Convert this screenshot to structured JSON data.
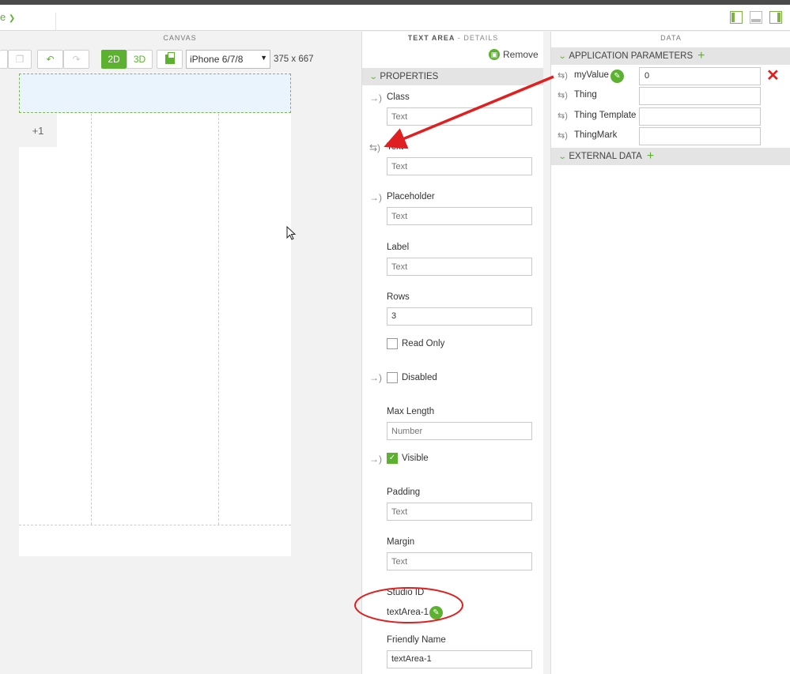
{
  "toolbar": {
    "menu_label": "e",
    "menu_chevron": "chevron-down-icon",
    "layout_icons": [
      "left-panel-layout-icon",
      "bottom-panel-layout-icon",
      "right-panel-layout-icon"
    ]
  },
  "canvas": {
    "header": "CANVAS",
    "mode_2d": "2D",
    "mode_3d": "3D",
    "device": "iPhone 6/7/8",
    "resolution": "375 x 667",
    "plus_badge": "+1"
  },
  "details": {
    "header_title": "TEXT AREA",
    "header_sub": " - DETAILS",
    "remove_label": "Remove",
    "section_properties": "PROPERTIES",
    "props": {
      "class_label": "Class",
      "class_placeholder": "Text",
      "text_label": "Text",
      "text_placeholder": "Text",
      "placeholder_label": "Placeholder",
      "placeholder_placeholder": "Text",
      "label_label": "Label",
      "label_placeholder": "Text",
      "rows_label": "Rows",
      "rows_value": "3",
      "readonly_label": "Read Only",
      "disabled_label": "Disabled",
      "maxlength_label": "Max Length",
      "maxlength_placeholder": "Number",
      "visible_label": "Visible",
      "visible_checked": true,
      "padding_label": "Padding",
      "padding_placeholder": "Text",
      "margin_label": "Margin",
      "margin_placeholder": "Text",
      "studio_id_label": "Studio ID",
      "studio_id_value": "textArea-1",
      "friendly_name_label": "Friendly Name",
      "friendly_name_value": "textArea-1"
    }
  },
  "data": {
    "header": "DATA",
    "app_params_label": "APPLICATION PARAMETERS",
    "params": [
      {
        "name": "myValue",
        "value": "0"
      },
      {
        "name": "Thing",
        "value": ""
      },
      {
        "name": "Thing Template",
        "value": ""
      },
      {
        "name": "ThingMark",
        "value": ""
      }
    ],
    "external_data_label": "EXTERNAL DATA"
  },
  "colors": {
    "accent": "#5cb230",
    "annotation_red": "#e02020"
  }
}
